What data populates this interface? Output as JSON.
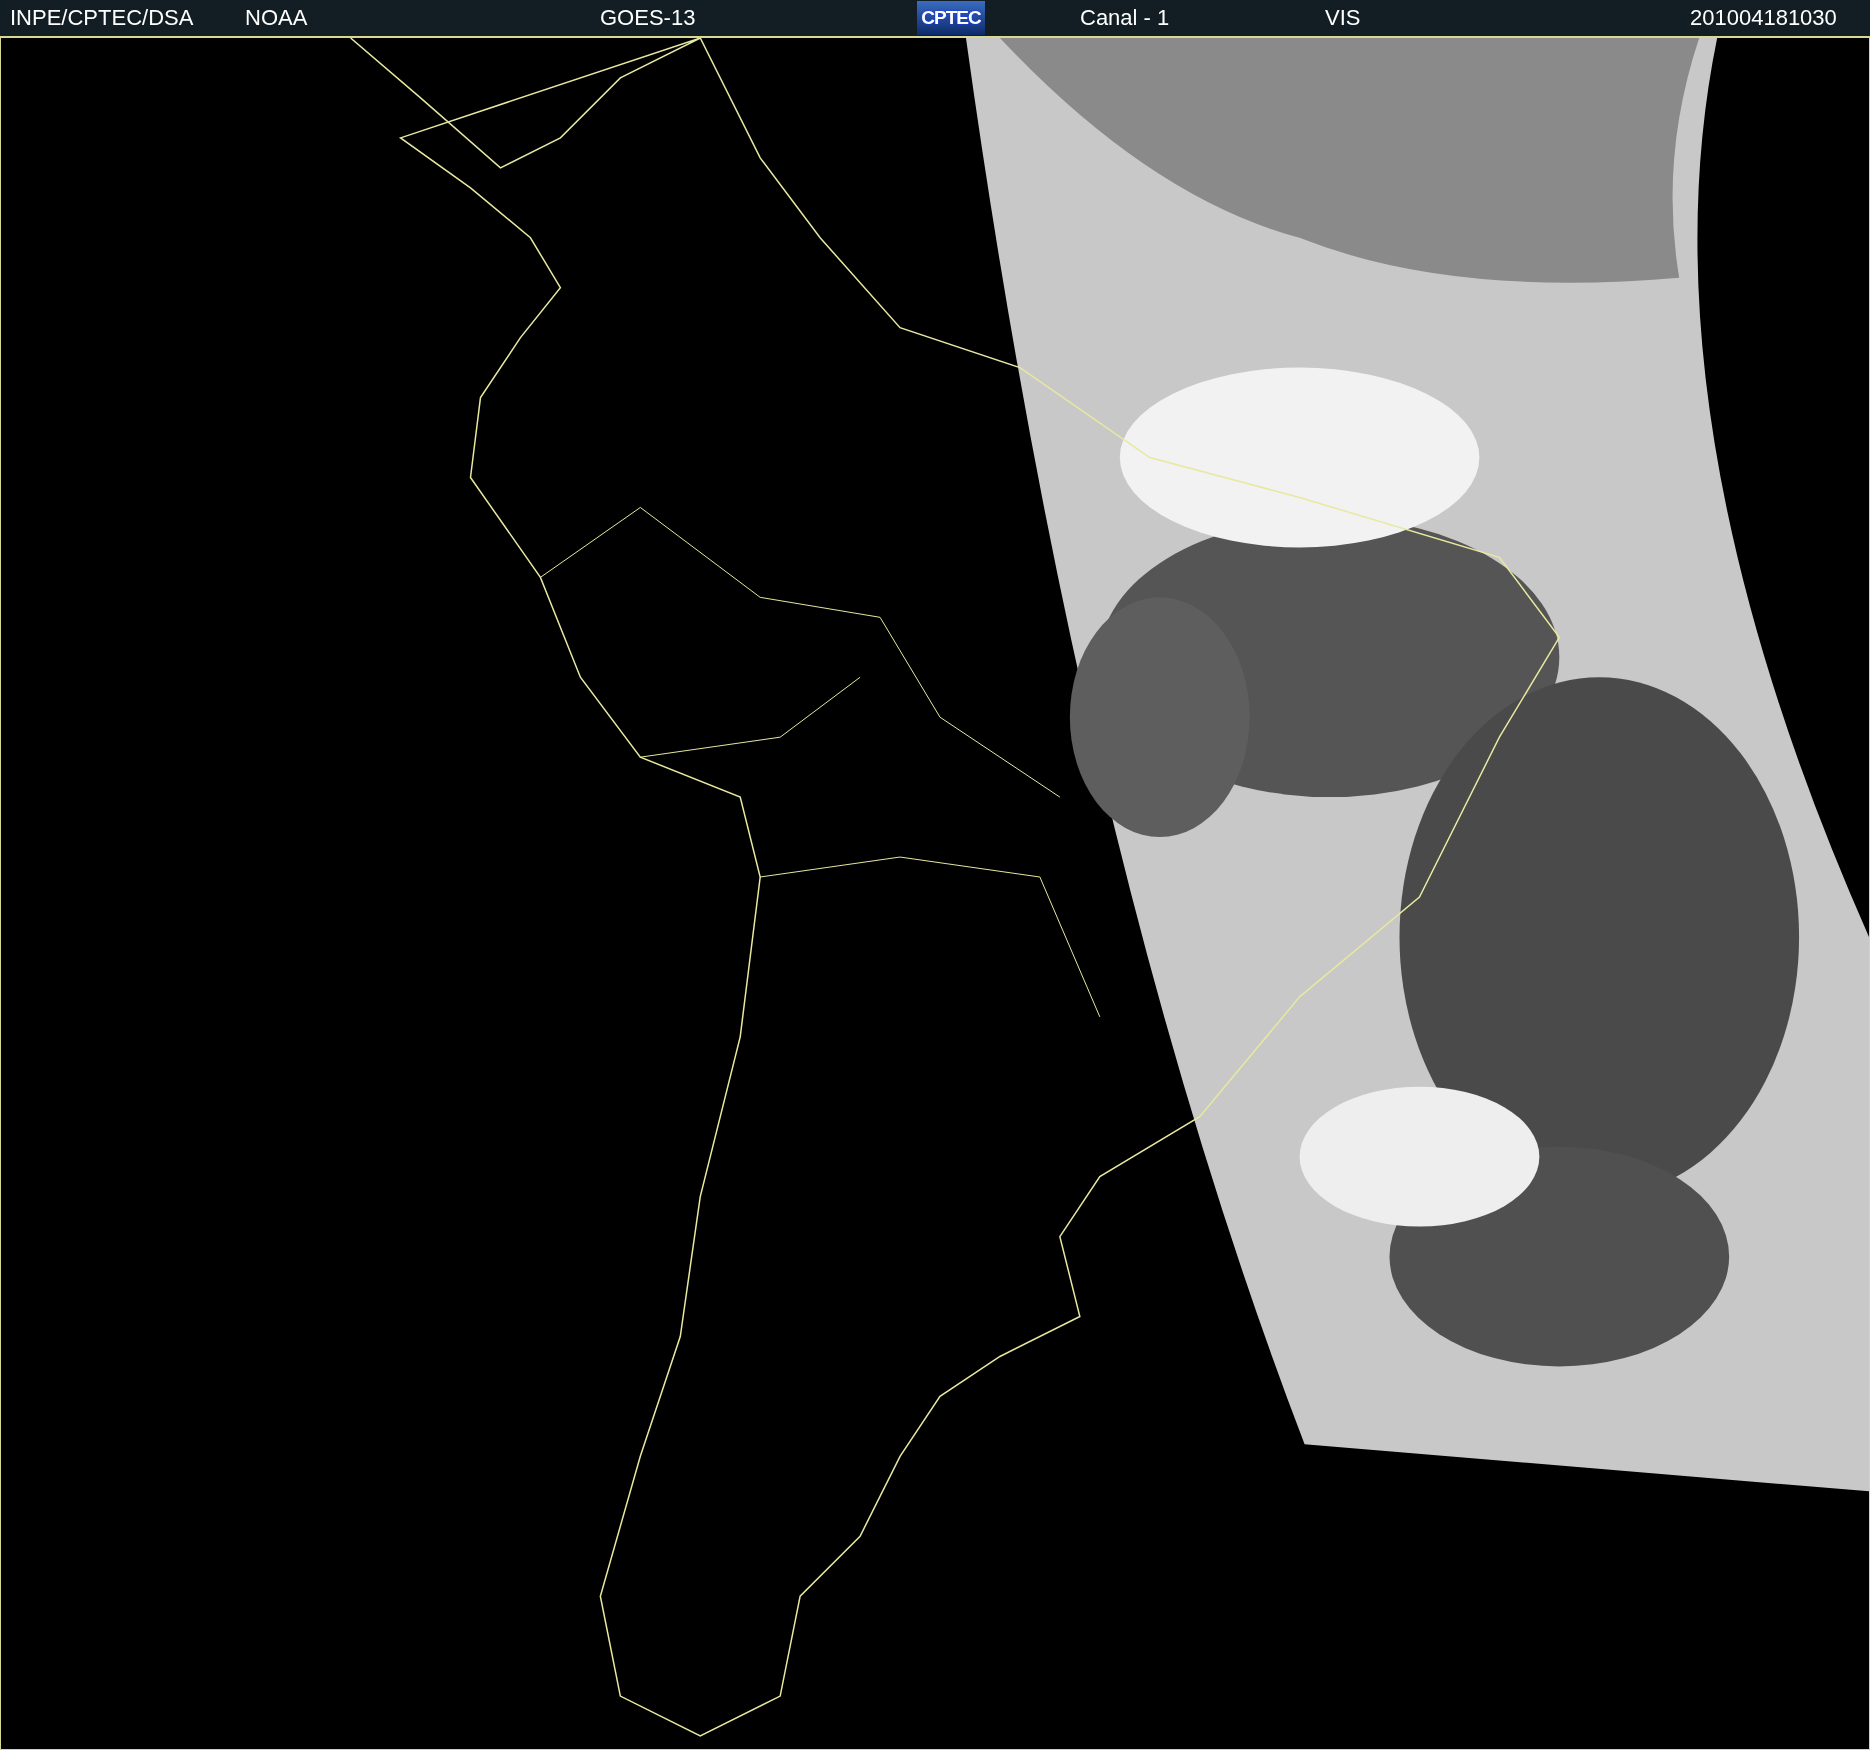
{
  "header": {
    "source": "INPE/CPTEC/DSA",
    "agency": "NOAA",
    "satellite": "GOES-13",
    "logo": "CPTEC",
    "channel": "Canal - 1",
    "band": "VIS",
    "timestamp": "201004181030"
  }
}
